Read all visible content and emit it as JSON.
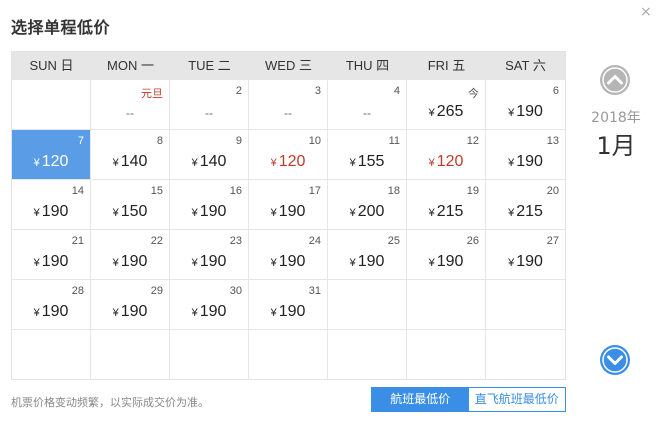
{
  "dialog": {
    "title": "选择单程低价",
    "close_glyph": "×"
  },
  "calendar": {
    "weekdays": [
      "SUN 日",
      "MON 一",
      "TUE 二",
      "WED 三",
      "THU 四",
      "FRI 五",
      "SAT 六"
    ],
    "year": "2018年",
    "month": "1月",
    "currency": "¥",
    "cells": [
      {
        "day": "",
        "price": ""
      },
      {
        "day": "元旦",
        "price": "--",
        "holiday": true
      },
      {
        "day": "2",
        "price": "--"
      },
      {
        "day": "3",
        "price": "--"
      },
      {
        "day": "4",
        "price": "--"
      },
      {
        "day": "今",
        "price": "265"
      },
      {
        "day": "6",
        "price": "190"
      },
      {
        "day": "7",
        "price": "120",
        "selected": true
      },
      {
        "day": "8",
        "price": "140"
      },
      {
        "day": "9",
        "price": "140"
      },
      {
        "day": "10",
        "price": "120",
        "low": true
      },
      {
        "day": "11",
        "price": "155"
      },
      {
        "day": "12",
        "price": "120",
        "low": true
      },
      {
        "day": "13",
        "price": "190"
      },
      {
        "day": "14",
        "price": "190"
      },
      {
        "day": "15",
        "price": "150"
      },
      {
        "day": "16",
        "price": "190"
      },
      {
        "day": "17",
        "price": "190"
      },
      {
        "day": "18",
        "price": "200"
      },
      {
        "day": "19",
        "price": "215"
      },
      {
        "day": "20",
        "price": "215"
      },
      {
        "day": "21",
        "price": "190"
      },
      {
        "day": "22",
        "price": "190"
      },
      {
        "day": "23",
        "price": "190"
      },
      {
        "day": "24",
        "price": "190"
      },
      {
        "day": "25",
        "price": "190"
      },
      {
        "day": "26",
        "price": "190"
      },
      {
        "day": "27",
        "price": "190"
      },
      {
        "day": "28",
        "price": "190"
      },
      {
        "day": "29",
        "price": "190"
      },
      {
        "day": "30",
        "price": "190"
      },
      {
        "day": "31",
        "price": "190"
      },
      {
        "day": "",
        "price": ""
      },
      {
        "day": "",
        "price": ""
      },
      {
        "day": "",
        "price": ""
      },
      {
        "day": "",
        "price": ""
      },
      {
        "day": "",
        "price": ""
      },
      {
        "day": "",
        "price": ""
      },
      {
        "day": "",
        "price": ""
      },
      {
        "day": "",
        "price": ""
      },
      {
        "day": "",
        "price": ""
      },
      {
        "day": "",
        "price": ""
      }
    ]
  },
  "footer": {
    "note": "机票价格变动频繁，以实际成交价为准。",
    "toggle": [
      "航班最低价",
      "直飞航班最低价"
    ],
    "active_index": 0
  },
  "icons": {
    "prev_month": "chevron-up-icon",
    "next_month": "chevron-down-icon"
  },
  "colors": {
    "selected_bg": "#5a9de6",
    "low_price": "#c0392b",
    "accent": "#3a8ee6",
    "header_bg": "#e6e6e6",
    "nav_circle": "#b5b5b5",
    "nav_circle_active": "#3a8ee6"
  }
}
